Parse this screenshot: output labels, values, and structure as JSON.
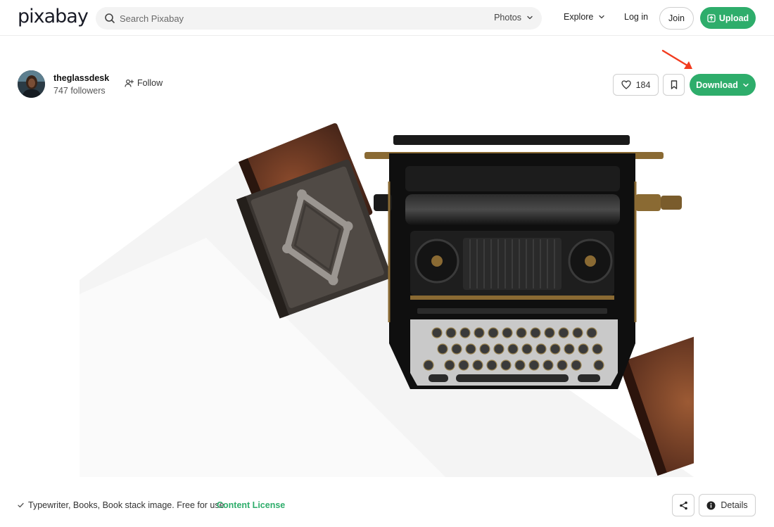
{
  "header": {
    "logo": "pixabay",
    "search_placeholder": "Search Pixabay",
    "search_type": "Photos",
    "explore": "Explore",
    "login": "Log in",
    "join": "Join",
    "upload": "Upload"
  },
  "user": {
    "name": "theglassdesk",
    "followers": "747 followers",
    "follow": "Follow"
  },
  "actions": {
    "likes": "184",
    "download": "Download"
  },
  "footer": {
    "description": "Typewriter, Books, Book stack image. Free for use",
    "license": "Content License",
    "details": "Details"
  },
  "colors": {
    "accent": "#2ead6b",
    "annotation_arrow": "#f23c1f"
  }
}
